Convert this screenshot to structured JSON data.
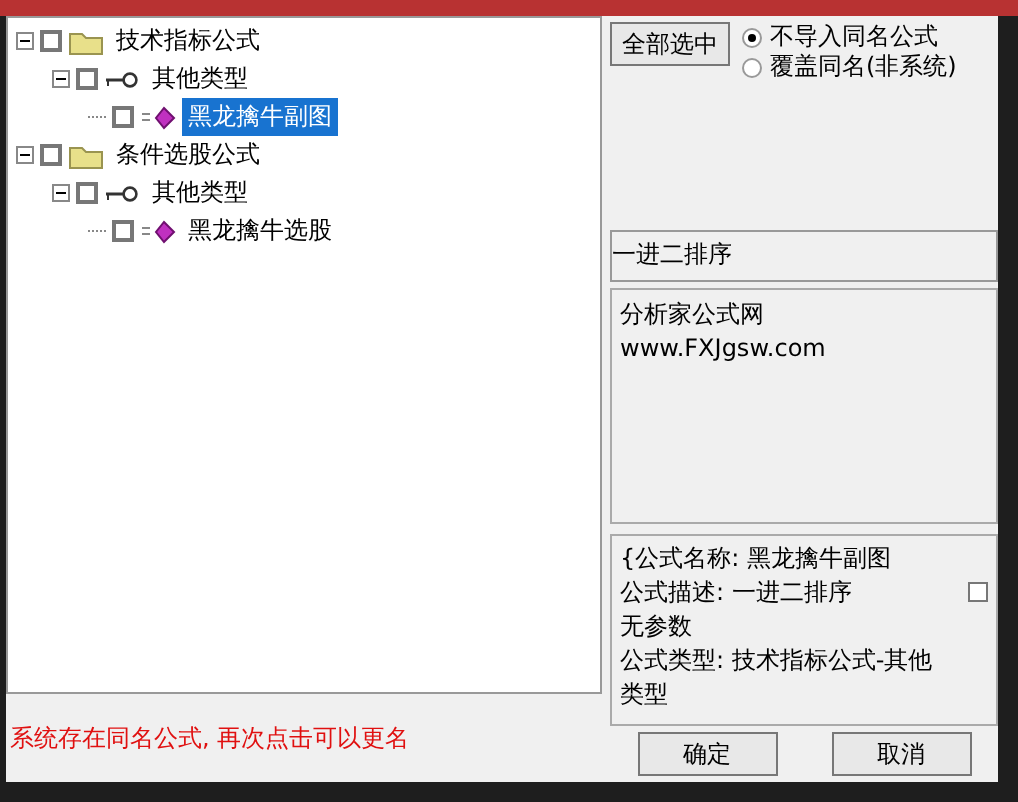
{
  "tree": [
    {
      "label": "技术指标公式",
      "kind": "folder",
      "checked": false,
      "expanded": true,
      "selected": false,
      "children": [
        {
          "label": "其他类型",
          "kind": "type",
          "checked": false,
          "expanded": true,
          "selected": false,
          "children": [
            {
              "label": "黑龙擒牛副图",
              "kind": "formula",
              "checked": false,
              "selected": true
            }
          ]
        }
      ]
    },
    {
      "label": "条件选股公式",
      "kind": "folder",
      "checked": false,
      "expanded": true,
      "selected": false,
      "children": [
        {
          "label": "其他类型",
          "kind": "type",
          "checked": false,
          "expanded": true,
          "selected": false,
          "children": [
            {
              "label": "黑龙擒牛选股",
              "kind": "formula",
              "checked": false,
              "selected": false
            }
          ]
        }
      ]
    }
  ],
  "select_all_button": "全部选中",
  "import_options": [
    {
      "label": "不导入同名公式",
      "selected": true
    },
    {
      "label": "覆盖同名(非系统)",
      "selected": false
    }
  ],
  "description": "一进二排序",
  "notes": [
    "分析家公式网",
    "www.FXJgsw.com"
  ],
  "info": {
    "lines": [
      "{公式名称: 黑龙擒牛副图",
      "公式描述: 一进二排序",
      "无参数",
      "公式类型: 技术指标公式-其他",
      "类型"
    ],
    "checked": false
  },
  "buttons": [
    "确定",
    "取消"
  ],
  "status_message": "系统存在同名公式, 再次点击可以更名"
}
